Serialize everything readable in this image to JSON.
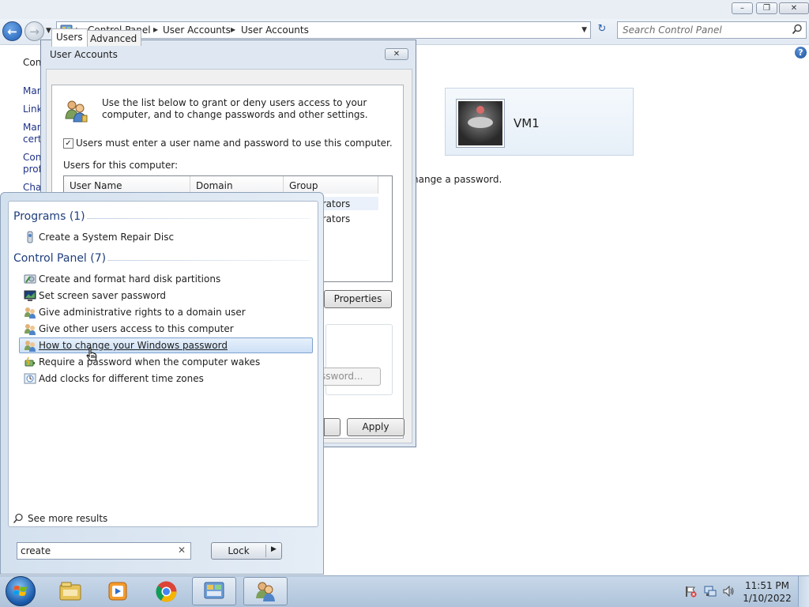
{
  "explorer": {
    "address_crumbs": [
      "Control Panel",
      "User Accounts",
      "User Accounts"
    ],
    "search_placeholder": "Search Control Panel",
    "left_links": [
      "Con",
      "Mar",
      "Link",
      "Mar",
      "certi",
      "Con",
      "profi",
      "Cha"
    ],
    "account_tile_name": "VM1",
    "change_password_text": "hange a password."
  },
  "dialog": {
    "title": "User Accounts",
    "tabs": [
      "Users",
      "Advanced"
    ],
    "intro_text": "Use the list below to grant or deny users access to your computer, and to change passwords and other settings.",
    "require_login_label": "Users must enter a user name and password to use this computer.",
    "require_login_checked": true,
    "users_list_label": "Users for this computer:",
    "columns": [
      "User Name",
      "Domain",
      "Group"
    ],
    "rows": [
      {
        "group": "trators"
      },
      {
        "group": "trators"
      }
    ],
    "properties_button": "Properties",
    "reset_password_button": "ssword...",
    "apply_button": "Apply"
  },
  "start_menu": {
    "programs_header": "Programs (1)",
    "programs": [
      {
        "label": "Create a System Repair Disc",
        "icon": "repair-disc-icon"
      }
    ],
    "control_panel_header": "Control Panel (7)",
    "control_panel_items": [
      {
        "label": "Create and format hard disk partitions",
        "icon": "disk-management-icon"
      },
      {
        "label": "Set screen saver password",
        "icon": "screen-saver-icon"
      },
      {
        "label": "Give administrative rights to a domain user",
        "icon": "users-icon"
      },
      {
        "label": "Give other users access to this computer",
        "icon": "users-icon"
      },
      {
        "label": "How to change your Windows password",
        "icon": "users-icon",
        "highlighted": true
      },
      {
        "label": "Require a password when the computer wakes",
        "icon": "power-options-icon"
      },
      {
        "label": "Add clocks for different time zones",
        "icon": "clock-icon"
      }
    ],
    "see_more": "See more results",
    "search_value": "create",
    "lock_button": "Lock"
  },
  "taskbar": {
    "time": "11:51 PM",
    "date": "1/10/2022",
    "pinned": [
      "file-explorer-icon",
      "media-player-icon",
      "chrome-icon",
      "control-panel-icon",
      "user-accounts-icon"
    ]
  },
  "colors": {
    "link": "#1e3287",
    "start_menu_header": "#1e3e7c",
    "highlight_border": "#7da2ce"
  }
}
